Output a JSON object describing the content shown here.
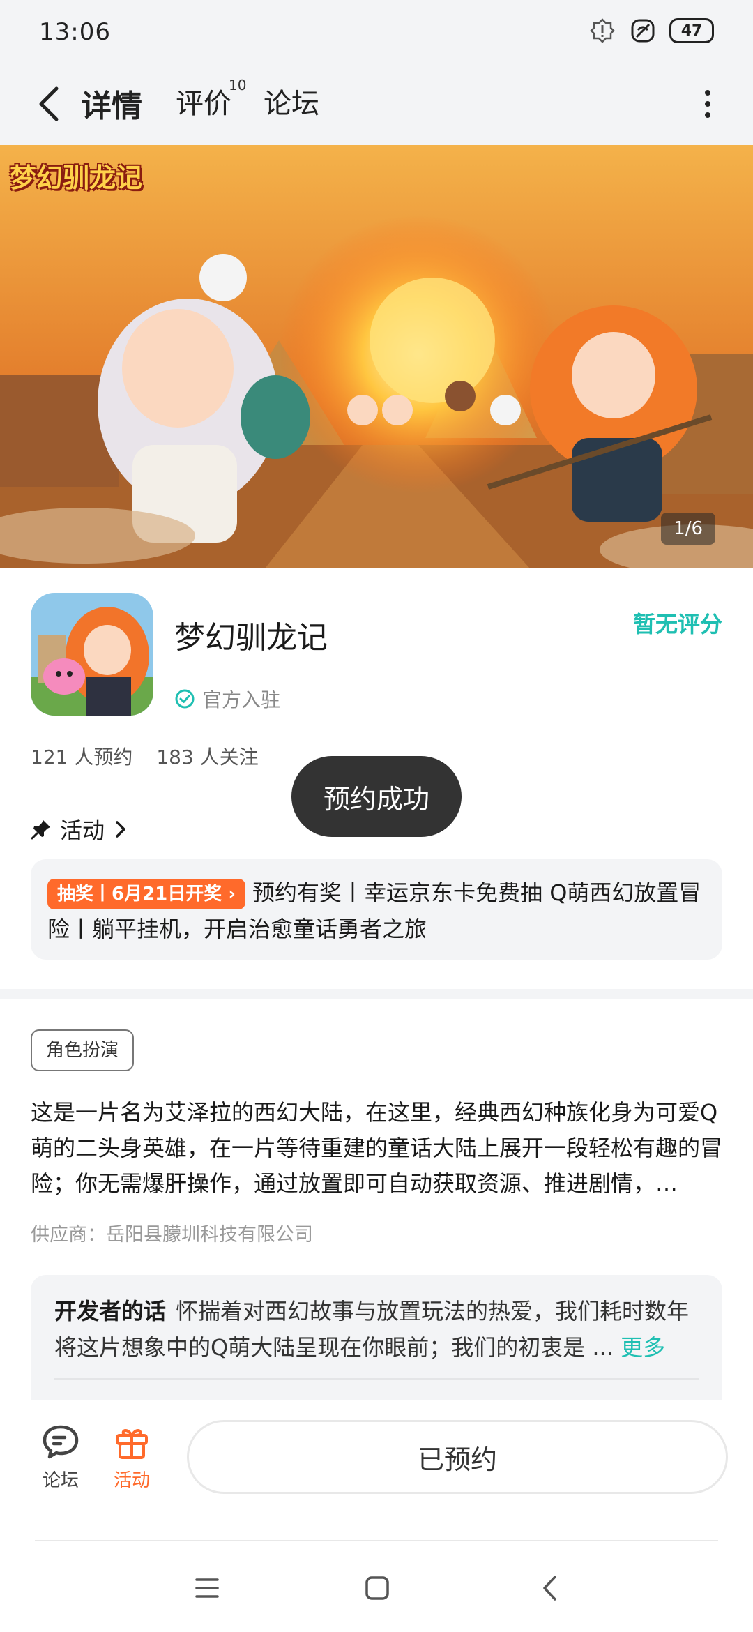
{
  "status_bar": {
    "time": "13:06",
    "battery": "47"
  },
  "nav": {
    "tabs": [
      {
        "label": "详情"
      },
      {
        "label": "评价",
        "badge": "10"
      },
      {
        "label": "论坛"
      }
    ]
  },
  "banner": {
    "logo_text": "梦幻驯龙记",
    "counter": "1/6"
  },
  "app": {
    "name": "梦幻驯龙记",
    "official_label": "官方入驻",
    "rating_text": "暂无评分",
    "reservations": "121 人预约",
    "followers": "183 人关注"
  },
  "toast": {
    "text": "预约成功"
  },
  "activity": {
    "header": "活动",
    "badge": "抽奖丨6月21日开奖 ›",
    "text": "预约有奖丨幸运京东卡免费抽 Q萌西幻放置冒险丨躺平挂机，开启治愈童话勇者之旅"
  },
  "details": {
    "genre": "角色扮演",
    "description": "这是一片名为艾泽拉的西幻大陆，在这里，经典西幻种族化身为可爱Q萌的二头身英雄，在一片等待重建的童话大陆上展开一段轻松有趣的冒险；你无需爆肝操作，通过放置即可自动获取资源、推进剧情，…",
    "supplier": "供应商：岳阳县朦圳科技有限公司",
    "dev_title": "开发者的话",
    "dev_text": "怀揣着对西幻故事与放置玩法的热爱，我们耗时数年将这片想象中的Q萌大陆呈现在你眼前；我们的初衷是 ...",
    "dev_more": "更多"
  },
  "bottom_bar": {
    "forum_label": "论坛",
    "activity_label": "活动",
    "reserved_label": "已预约"
  },
  "colors": {
    "accent": "#1fbfb2",
    "orange": "#ff6a2b"
  }
}
